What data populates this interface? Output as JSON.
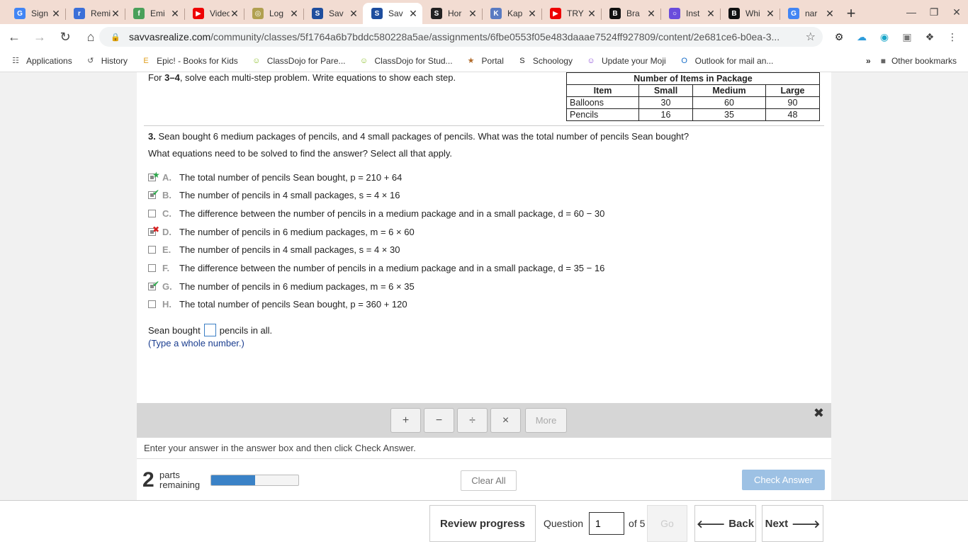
{
  "browser": {
    "tabs": [
      {
        "title": "Sign",
        "icon": "google-g",
        "color": "#4285f4",
        "active": false
      },
      {
        "title": "Remind",
        "icon": "remind",
        "color": "#3b6fd8",
        "active": false
      },
      {
        "title": "Emi",
        "icon": "frog",
        "color": "#4aa05a",
        "active": false
      },
      {
        "title": "Video",
        "icon": "youtube",
        "color": "#e00",
        "active": false
      },
      {
        "title": "Log",
        "icon": "log",
        "color": "#b0a050",
        "active": false
      },
      {
        "title": "Sav",
        "icon": "savvas",
        "color": "#1f4e9e",
        "active": false
      },
      {
        "title": "Sav",
        "icon": "savvas",
        "color": "#1f4e9e",
        "active": true
      },
      {
        "title": "Hor",
        "icon": "s-circle",
        "color": "#222",
        "active": false
      },
      {
        "title": "Kap",
        "icon": "kap",
        "color": "#5a7bc2",
        "active": false
      },
      {
        "title": "TRY",
        "icon": "youtube",
        "color": "#e00",
        "active": false
      },
      {
        "title": "Bra",
        "icon": "b",
        "color": "#111",
        "active": false
      },
      {
        "title": "Inst",
        "icon": "instagram",
        "color": "#6a4cdc",
        "active": false
      },
      {
        "title": "Whi",
        "icon": "b",
        "color": "#111",
        "active": false
      },
      {
        "title": "nar",
        "icon": "google-g",
        "color": "#4285f4",
        "active": false
      }
    ],
    "url_domain": "savvasrealize.com",
    "url_path": "/community/classes/5f1764a6b7bddc580228a5ae/assignments/6fbe0553f05e483daaae7524ff927809/content/2e681ce6-b0ea-3...",
    "bookmarks": [
      {
        "label": "Applications",
        "icon": "grid-icon"
      },
      {
        "label": "History",
        "icon": "history-icon"
      },
      {
        "label": "Epic! - Books for Kids",
        "icon": "epic-icon"
      },
      {
        "label": "ClassDojo for Pare...",
        "icon": "dojo-icon"
      },
      {
        "label": "ClassDojo for Stud...",
        "icon": "dojo-icon"
      },
      {
        "label": "Portal",
        "icon": "portal-icon"
      },
      {
        "label": "Schoology",
        "icon": "schoology-icon"
      },
      {
        "label": "Update your Moji",
        "icon": "moji-icon"
      },
      {
        "label": "Outlook for mail an...",
        "icon": "outlook-icon"
      }
    ],
    "other_bookmarks": "Other bookmarks"
  },
  "problem": {
    "instructions_pre": "For ",
    "instructions_bold": "3–4",
    "instructions_post": ", solve each multi-step problem. Write equations to show each step.",
    "table": {
      "caption": "Number of Items in Package",
      "headers": [
        "Item",
        "Small",
        "Medium",
        "Large"
      ],
      "rows": [
        [
          "Balloons",
          "30",
          "60",
          "90"
        ],
        [
          "Pencils",
          "16",
          "35",
          "48"
        ]
      ]
    },
    "question_num": "3.",
    "question_text": " Sean bought 6 medium packages of pencils, and 4 small packages of pencils. What was the total number of pencils Sean bought?",
    "subquestion": "What equations need to be solved to find the answer? Select all that apply.",
    "options": [
      {
        "letter": "A.",
        "text": "The total number of pencils Sean bought, p = 210 + 64",
        "checked": true,
        "mark": "star"
      },
      {
        "letter": "B.",
        "text": "The number of pencils in 4 small packages, s = 4 × 16",
        "checked": true,
        "mark": "check"
      },
      {
        "letter": "C.",
        "text": "The difference between the number of pencils in a medium package and in a small package, d = 60 − 30",
        "checked": false,
        "mark": ""
      },
      {
        "letter": "D.",
        "text": "The number of pencils in 6 medium packages, m = 6 × 60",
        "checked": true,
        "mark": "cross"
      },
      {
        "letter": "E.",
        "text": "The number of pencils in 4 small packages, s = 4 × 30",
        "checked": false,
        "mark": ""
      },
      {
        "letter": "F.",
        "text": "The difference between the number of pencils in a medium package and in a small package, d = 35 − 16",
        "checked": false,
        "mark": ""
      },
      {
        "letter": "G.",
        "text": "The number of pencils in 6 medium packages, m = 6 × 35",
        "checked": true,
        "mark": "check"
      },
      {
        "letter": "H.",
        "text": "The total number of pencils Sean bought, p = 360 + 120",
        "checked": false,
        "mark": ""
      }
    ],
    "answer_pre": "Sean bought",
    "answer_post": "pencils in all.",
    "hint": "(Type a whole number.)"
  },
  "palette": {
    "buttons": [
      "+",
      "−",
      "÷",
      "×"
    ],
    "more_label": "More",
    "close": "✖"
  },
  "status": "Enter your answer in the answer box and then click Check Answer.",
  "parts": {
    "count": "2",
    "label_line1": "parts",
    "label_line2": "remaining",
    "progress": 0.5
  },
  "actions": {
    "clear_all": "Clear All",
    "check_answer": "Check Answer"
  },
  "footer": {
    "review": "Review progress",
    "question_label": "Question",
    "question_value": "1",
    "of_label": "of 5",
    "go": "Go",
    "back": "Back",
    "next": "Next"
  }
}
